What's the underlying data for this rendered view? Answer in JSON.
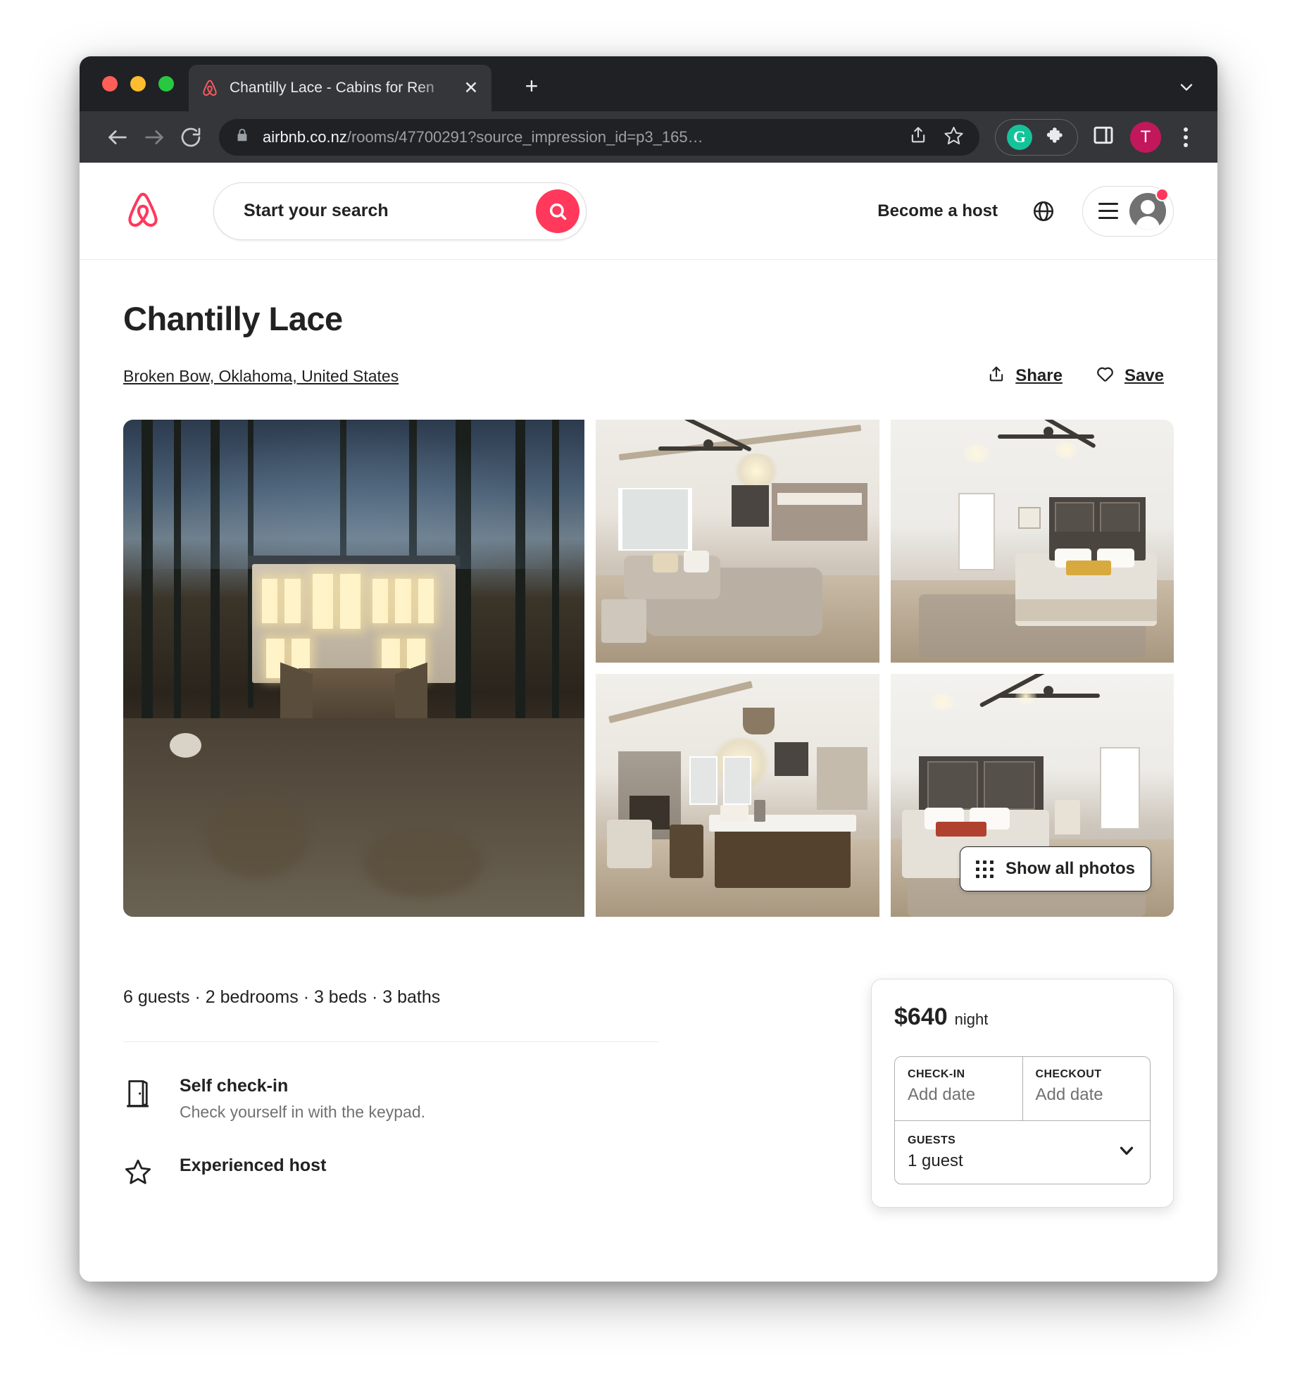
{
  "browser": {
    "tab": {
      "title": "Chantilly Lace - Cabins for Ren",
      "favicon_name": "airbnb-favicon",
      "close_label": "✕"
    },
    "new_tab_label": "+",
    "toolbar": {
      "back_label": "←",
      "forward_label": "→",
      "reload_label": "⟳",
      "url_domain": "airbnb.co.nz",
      "url_path": "/rooms/47700291?source_impression_id=p3_165…",
      "lock_icon": "lock-icon",
      "share_icon": "share-icon",
      "bookmark_icon": "star-icon",
      "grammarly_label": "G",
      "extensions_icon": "puzzle-piece-icon",
      "side_panel_icon": "side-panel-icon",
      "profile_initial": "T",
      "menu_icon": "kebab-menu-icon"
    }
  },
  "site_header": {
    "logo_name": "airbnb-belo-logo",
    "search_placeholder": "Start your search",
    "search_icon": "search-icon",
    "become_host_label": "Become a host",
    "globe_icon": "globe-icon",
    "menu_icon": "hamburger-menu-icon",
    "avatar_icon": "user-avatar-icon",
    "has_notification": true
  },
  "listing": {
    "title": "Chantilly Lace",
    "location": "Broken Bow, Oklahoma, United States",
    "share_label": "Share",
    "save_label": "Save",
    "share_icon": "share-upload-icon",
    "save_icon": "heart-icon",
    "show_all_photos_label": "Show all photos",
    "show_all_photos_icon": "grid-icon",
    "photos": [
      {
        "name": "exterior-cabin-twilight",
        "alt": "Cabin exterior at twilight among pine trees"
      },
      {
        "name": "living-room-vaulted",
        "alt": "Living room with vaulted ceiling and sectional sofa"
      },
      {
        "name": "bedroom-king",
        "alt": "Bedroom with king bed and ceiling fan"
      },
      {
        "name": "kitchen-island-fireplace",
        "alt": "Kitchen island with chandelier and stone fireplace"
      },
      {
        "name": "bedroom-second",
        "alt": "Second bedroom with dark headboard and ceiling fan"
      }
    ],
    "facts": "6 guests · 2 bedrooms · 3 beds · 3 baths",
    "amenities": [
      {
        "icon": "door-icon",
        "title": "Self check-in",
        "subtitle": "Check yourself in with the keypad."
      },
      {
        "icon": "star-outline-icon",
        "title": "Experienced host",
        "subtitle": ""
      }
    ]
  },
  "booking": {
    "price": "$640",
    "price_unit": "night",
    "checkin_label": "CHECK-IN",
    "checkin_value": "Add date",
    "checkout_label": "CHECKOUT",
    "checkout_value": "Add date",
    "guests_label": "GUESTS",
    "guests_value": "1 guest",
    "chevron_icon": "chevron-down-icon"
  },
  "colors": {
    "brand": "#ff385c",
    "text": "#222222",
    "muted": "#717171",
    "chrome": "#35363a",
    "chrome_dark": "#202124",
    "grammarly": "#15c39a",
    "profile": "#c2185b"
  }
}
